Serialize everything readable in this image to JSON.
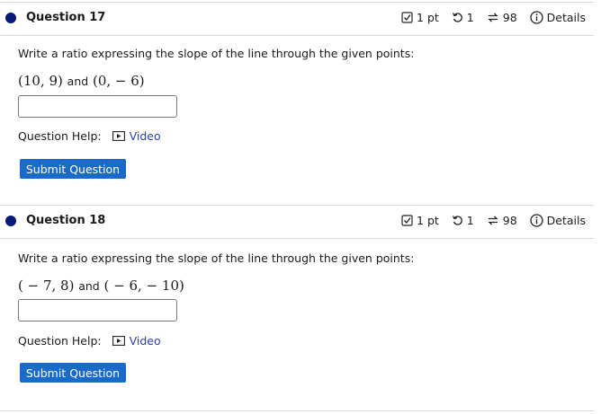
{
  "questions": [
    {
      "title": "Question 17",
      "points": "1 pt",
      "attempts": "1",
      "tries": "98",
      "details": "Details",
      "prompt": "Write a ratio expressing the slope of the line through the given points:",
      "point_a": "(10, 9)",
      "conj": "and",
      "point_b": "(0,  − 6)",
      "answer_value": "",
      "help_label": "Question Help:",
      "video_label": "Video",
      "submit_label": "Submit Question"
    },
    {
      "title": "Question 18",
      "points": "1 pt",
      "attempts": "1",
      "tries": "98",
      "details": "Details",
      "prompt": "Write a ratio expressing the slope of the line through the given points:",
      "point_a": "( − 7, 8)",
      "conj": "and",
      "point_b": "( − 6,  − 10)",
      "answer_value": "",
      "help_label": "Question Help:",
      "video_label": "Video",
      "submit_label": "Submit Question"
    }
  ],
  "colors": {
    "dot": "#0a1a7a",
    "button": "#1a6bc9",
    "link": "#2a3fb0"
  }
}
